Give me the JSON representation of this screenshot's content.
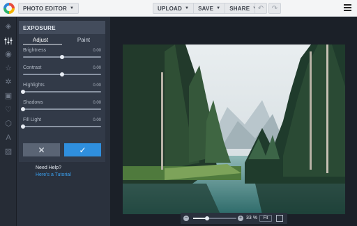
{
  "topbar": {
    "app_title": "PHOTO EDITOR",
    "upload_label": "UPLOAD",
    "save_label": "SAVE",
    "share_label": "SHARE",
    "undo_icon": "undo-icon",
    "redo_icon": "redo-icon",
    "menu_icon": "hamburger-menu-icon"
  },
  "rail": {
    "icons": [
      "layers-icon",
      "sliders-icon",
      "eye-icon",
      "star-icon",
      "gear-icon",
      "frame-icon",
      "heart-icon",
      "shape-icon",
      "text-icon",
      "texture-icon"
    ]
  },
  "panel": {
    "title": "EXPOSURE",
    "tabs": [
      {
        "label": "Adjust",
        "active": true
      },
      {
        "label": "Paint",
        "active": false
      }
    ],
    "sliders": [
      {
        "label": "Brightness",
        "value": "0.00",
        "level": 0.5
      },
      {
        "label": "Contrast",
        "value": "0.00",
        "level": 0.5
      },
      {
        "label": "Highlights",
        "value": "0.00",
        "level": 0.0
      },
      {
        "label": "Shadows",
        "value": "0.00",
        "level": 0.0
      },
      {
        "label": "Fill Light",
        "value": "0.00",
        "level": 0.0
      }
    ],
    "help_title": "Need Help?",
    "help_link": "Here's a Tutorial"
  },
  "zoom": {
    "value": "33 %",
    "level": 0.33,
    "fit_label": "Fit"
  },
  "colors": {
    "accent": "#2f8fde",
    "link": "#3aa0f0"
  }
}
